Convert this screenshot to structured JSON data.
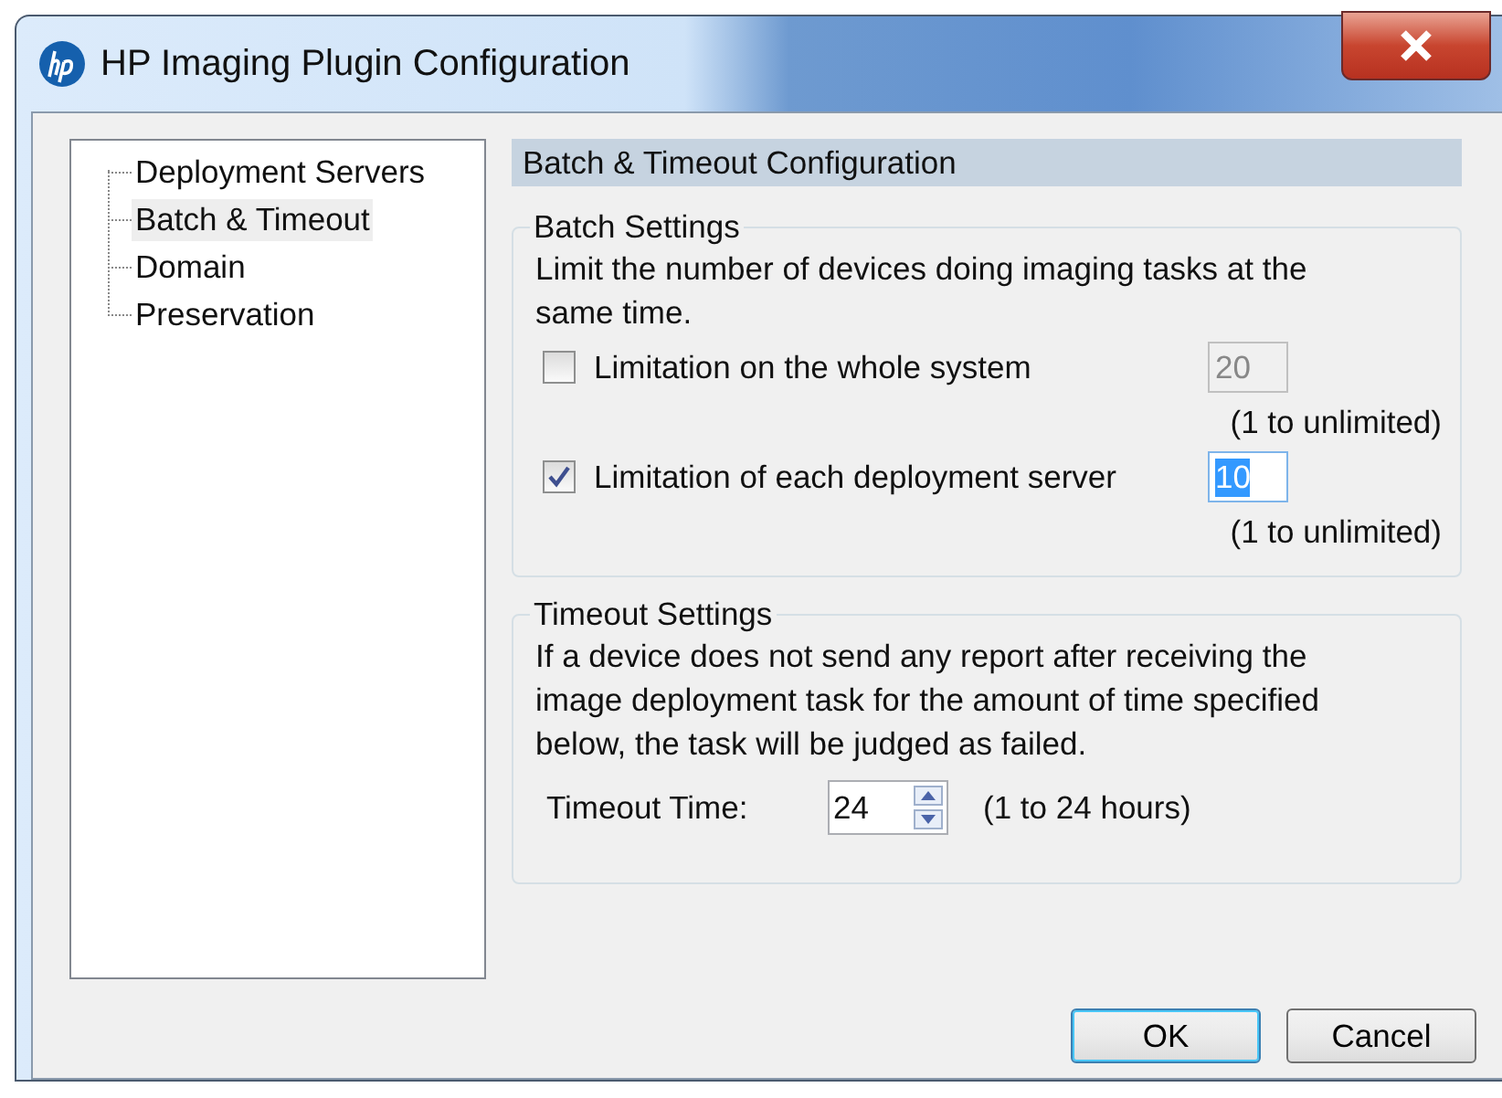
{
  "window": {
    "title": "HP Imaging Plugin Configuration"
  },
  "tree": {
    "items": [
      {
        "label": "Deployment Servers",
        "selected": false
      },
      {
        "label": "Batch & Timeout",
        "selected": true
      },
      {
        "label": "Domain",
        "selected": false
      },
      {
        "label": "Preservation",
        "selected": false
      }
    ]
  },
  "panel": {
    "title": "Batch & Timeout Configuration"
  },
  "batch": {
    "title": "Batch Settings",
    "description": "Limit the number of devices doing imaging tasks at the same time.",
    "limits": [
      {
        "label": "Limitation on the whole system",
        "checked": false,
        "value": "20",
        "disabled": true,
        "selected": false,
        "hint": "(1 to unlimited)"
      },
      {
        "label": "Limitation of each deployment server",
        "checked": true,
        "value": "10",
        "disabled": false,
        "selected": true,
        "hint": "(1 to unlimited)"
      }
    ]
  },
  "timeout": {
    "title": "Timeout Settings",
    "description": "If a device does not send any report after receiving the image deployment task for the amount of time specified below, the task will be judged as failed.",
    "label": "Timeout Time:",
    "value": "24",
    "hint": "(1 to 24 hours)"
  },
  "buttons": [
    {
      "label": "OK",
      "selected": true
    },
    {
      "label": "Cancel",
      "selected": false
    }
  ]
}
